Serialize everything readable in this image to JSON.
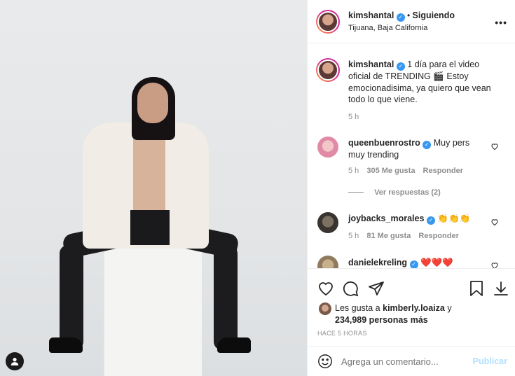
{
  "post": {
    "image_alt": "",
    "tag_icon": "user-tag-icon"
  },
  "header": {
    "username": "kimshantal",
    "separator": "•",
    "follow_status": "Siguiendo",
    "location": "Tijuana, Baja California"
  },
  "caption": {
    "username": "kimshantal",
    "text_line1": "1 día para el video",
    "text_line2": "oficial de TRENDING 🎬 Estoy",
    "text_line3": "emocionadisima, ya quiero que vean",
    "text_line4": "todo lo que viene.",
    "time": "5 h"
  },
  "comments": [
    {
      "username": "queenbuenrostro",
      "text_line1": "Muy pers",
      "text_line2": "muy trending",
      "time": "5 h",
      "likes": "305 Me gusta",
      "reply": "Responder",
      "view_replies": "Ver respuestas (2)"
    },
    {
      "username": "joybacks_morales",
      "text": "👏👏👏",
      "time": "5 h",
      "likes": "81 Me gusta",
      "reply": "Responder"
    },
    {
      "username": "danielekreling",
      "text": "❤️❤️❤️"
    }
  ],
  "likes": {
    "prefix": "Les gusta a",
    "user": "kimberly.loaiza",
    "conj": "y",
    "count": "234,989 personas más"
  },
  "timestamp": "HACE 5 HORAS",
  "comment_box": {
    "placeholder": "Agrega un comentario...",
    "publish": "Publicar"
  }
}
